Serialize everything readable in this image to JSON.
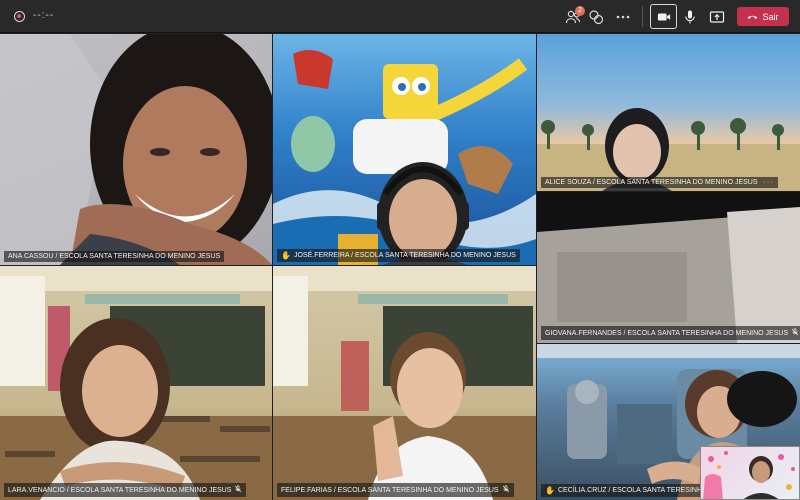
{
  "topbar": {
    "timer": "--:--",
    "participants_badge": "2",
    "leave_label": "Sair"
  },
  "colors": {
    "topbar_bg": "#292929",
    "leave_button": "#c4314b",
    "badge": "#e16e55",
    "raised_hand": "#f2c23a"
  },
  "participants": [
    {
      "name": "ANA CASSOU / ESCOLA SANTA TERESINHA DO MENINO JESUS",
      "hand_raised": false,
      "muted": false
    },
    {
      "name": "JOSÉ.FERREIRA / ESCOLA SANTA TERESINHA DO MENINO JESUS",
      "hand_raised": true,
      "muted": false
    },
    {
      "name": "ALICE SOUZA / ESCOLA SANTA TERESINHA DO MENINO JESUS",
      "hand_raised": false,
      "muted": false,
      "more": "···"
    },
    {
      "name": "GIOVANA.FERNANDES / ESCOLA SANTA TERESINHA DO MENINO JESUS",
      "hand_raised": false,
      "muted": true
    },
    {
      "name": "LARA.VENANCIO / ESCOLA SANTA TERESINHA DO MENINO JESUS",
      "hand_raised": false,
      "muted": true
    },
    {
      "name": "FELIPE.FARIAS / ESCOLA SANTA TERESINHA DO MENINO JESUS",
      "hand_raised": false,
      "muted": true
    },
    {
      "name": "CECÍLIA.CRUZ / ESCOLA SANTA TERESINHA DO MENINO JESUS",
      "hand_raised": true,
      "muted": false
    }
  ],
  "icons": [
    "record-icon",
    "participants-icon",
    "reactions-icon",
    "more-options-icon",
    "camera-icon",
    "mic-icon",
    "share-screen-icon",
    "hang-up-icon",
    "raised-hand-icon",
    "mic-off-icon"
  ]
}
